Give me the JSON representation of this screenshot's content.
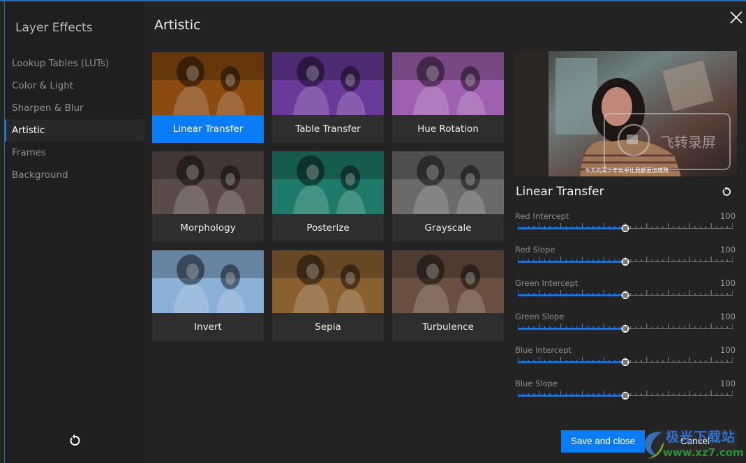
{
  "sidebar": {
    "title": "Layer Effects",
    "items": [
      {
        "label": "Lookup Tables (LUTs)",
        "active": false
      },
      {
        "label": "Color & Light",
        "active": false
      },
      {
        "label": "Sharpen & Blur",
        "active": false
      },
      {
        "label": "Artistic",
        "active": true
      },
      {
        "label": "Frames",
        "active": false
      },
      {
        "label": "Background",
        "active": false
      }
    ],
    "reset_icon": "reset-icon"
  },
  "main": {
    "title": "Artistic",
    "close_icon": "close-icon",
    "effects": [
      {
        "label": "Linear Transfer",
        "selected": true,
        "tint": "#8a4a10"
      },
      {
        "label": "Table Transfer",
        "selected": false,
        "tint": "#6a3a9a"
      },
      {
        "label": "Hue Rotation",
        "selected": false,
        "tint": "#a060b0"
      },
      {
        "label": "Morphology",
        "selected": false,
        "tint": "#5a4a48"
      },
      {
        "label": "Posterize",
        "selected": false,
        "tint": "#1e7a6a"
      },
      {
        "label": "Grayscale",
        "selected": false,
        "tint": "#6a6a6a"
      },
      {
        "label": "Invert",
        "selected": false,
        "tint": "#8ab0d8"
      },
      {
        "label": "Sepia",
        "selected": false,
        "tint": "#8a6030"
      },
      {
        "label": "Turbulence",
        "selected": false,
        "tint": "#6a5040"
      }
    ]
  },
  "preview": {
    "subtitle_text": "今天的青少年似乎比我都更加成熟",
    "watermark_text": "飞转录屏"
  },
  "panel": {
    "title": "Linear Transfer",
    "reset_icon": "reset-icon",
    "sliders": [
      {
        "label": "Red Intercept",
        "value": "100",
        "fraction": 0.5
      },
      {
        "label": "Red Slope",
        "value": "100",
        "fraction": 0.5
      },
      {
        "label": "Green Intercept",
        "value": "100",
        "fraction": 0.5
      },
      {
        "label": "Green Slope",
        "value": "100",
        "fraction": 0.5
      },
      {
        "label": "Blue Intercept",
        "value": "100",
        "fraction": 0.5
      },
      {
        "label": "Blue Slope",
        "value": "100",
        "fraction": 0.5
      }
    ]
  },
  "footer": {
    "save_label": "Save and close",
    "cancel_label": "Cancel"
  },
  "site_watermark": {
    "text": "极光下载站",
    "url": "www.xz7.com"
  },
  "colors": {
    "accent": "#0a7cf5",
    "background": "#232323",
    "sidebar": "#1f1f1f"
  }
}
